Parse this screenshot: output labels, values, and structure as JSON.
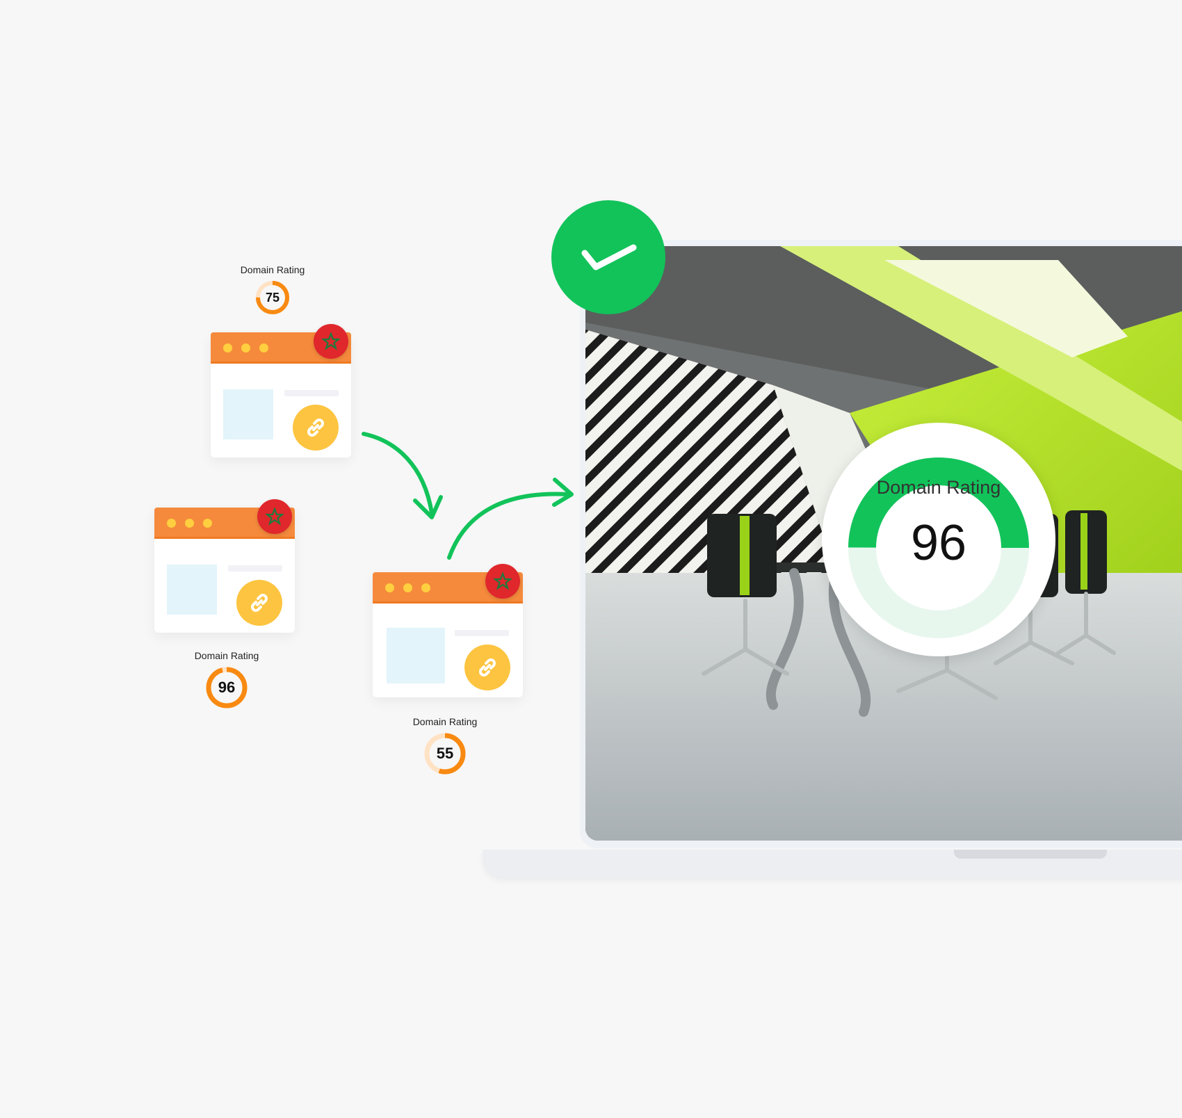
{
  "colors": {
    "background": "#f7f7f7",
    "card_bar": "#f58a3c",
    "flag_red": "#e0272c",
    "star_green": "#1d7a3c",
    "link_coin": "#fcc440",
    "ring_orange": "#f88a12",
    "accent_green": "#12c35a"
  },
  "sites": [
    {
      "dr_label": "Domain Rating",
      "dr_value": "75",
      "flag_icon": "morocco-flag-icon",
      "link_icon": "link-icon"
    },
    {
      "dr_label": "Domain Rating",
      "dr_value": "96",
      "flag_icon": "morocco-flag-icon",
      "link_icon": "link-icon"
    },
    {
      "dr_label": "Domain Rating",
      "dr_value": "55",
      "flag_icon": "morocco-flag-icon",
      "link_icon": "link-icon"
    }
  ],
  "arrows": [
    "curved-arrow-down",
    "curved-arrow-right"
  ],
  "laptop": {
    "check_icon": "checkmark-icon",
    "screen_image": "office-meeting-room-photo",
    "domain_rating": {
      "label": "Domain Rating",
      "value": "96",
      "fill": 0.96
    }
  }
}
